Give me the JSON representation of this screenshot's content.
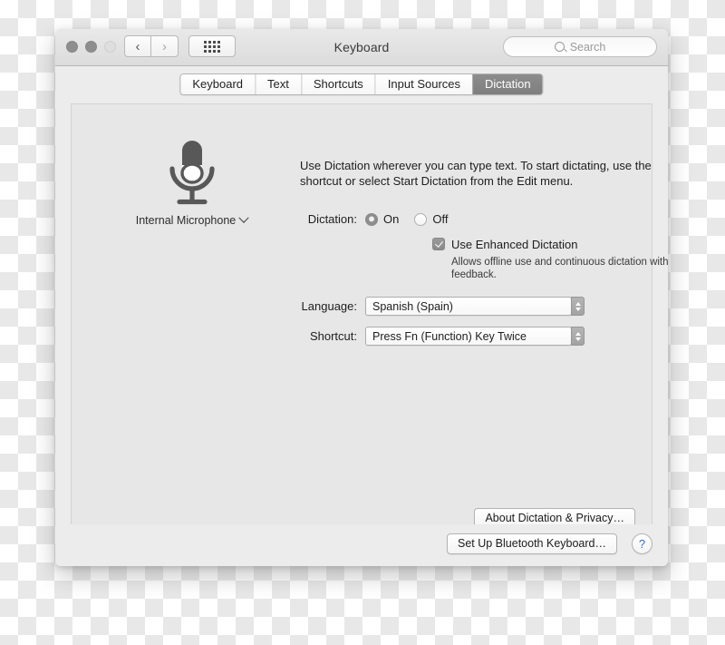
{
  "window": {
    "title": "Keyboard",
    "traffic_lights": [
      "close",
      "minimize",
      "zoom"
    ],
    "nav_back_icon": "chevron-left-icon",
    "nav_forward_icon": "chevron-right-icon",
    "show_all_icon": "grid-dots-icon",
    "search": {
      "icon": "search-icon",
      "placeholder": "Search",
      "value": ""
    }
  },
  "tabs": [
    {
      "label": "Keyboard",
      "active": false
    },
    {
      "label": "Text",
      "active": false
    },
    {
      "label": "Shortcuts",
      "active": false
    },
    {
      "label": "Input Sources",
      "active": false
    },
    {
      "label": "Dictation",
      "active": true
    }
  ],
  "panel": {
    "microphone": {
      "icon": "microphone-icon",
      "label": "Internal Microphone",
      "chevron_icon": "chevron-down-icon"
    },
    "description": "Use Dictation wherever you can type text. To start dictating, use the shortcut or select Start Dictation from the Edit menu.",
    "dictation": {
      "label": "Dictation:",
      "options": [
        {
          "label": "On",
          "selected": true
        },
        {
          "label": "Off",
          "selected": false
        }
      ]
    },
    "enhanced": {
      "label": "Use Enhanced Dictation",
      "checked": true,
      "sublabel": "Allows offline use and continuous dictation with live feedback."
    },
    "language": {
      "label": "Language:",
      "value": "Spanish (Spain)"
    },
    "shortcut": {
      "label": "Shortcut:",
      "value": "Press Fn (Function) Key Twice"
    },
    "about_button": "About Dictation & Privacy…"
  },
  "bottom": {
    "bluetooth_button": "Set Up Bluetooth Keyboard…",
    "help_button": "?"
  },
  "colors": {
    "window_bg": "#ececec",
    "panel_bg": "#e7e7e7",
    "active_tab_bg": "#858585",
    "help_blue": "#2f6fd8",
    "mic_gray": "#585858"
  }
}
